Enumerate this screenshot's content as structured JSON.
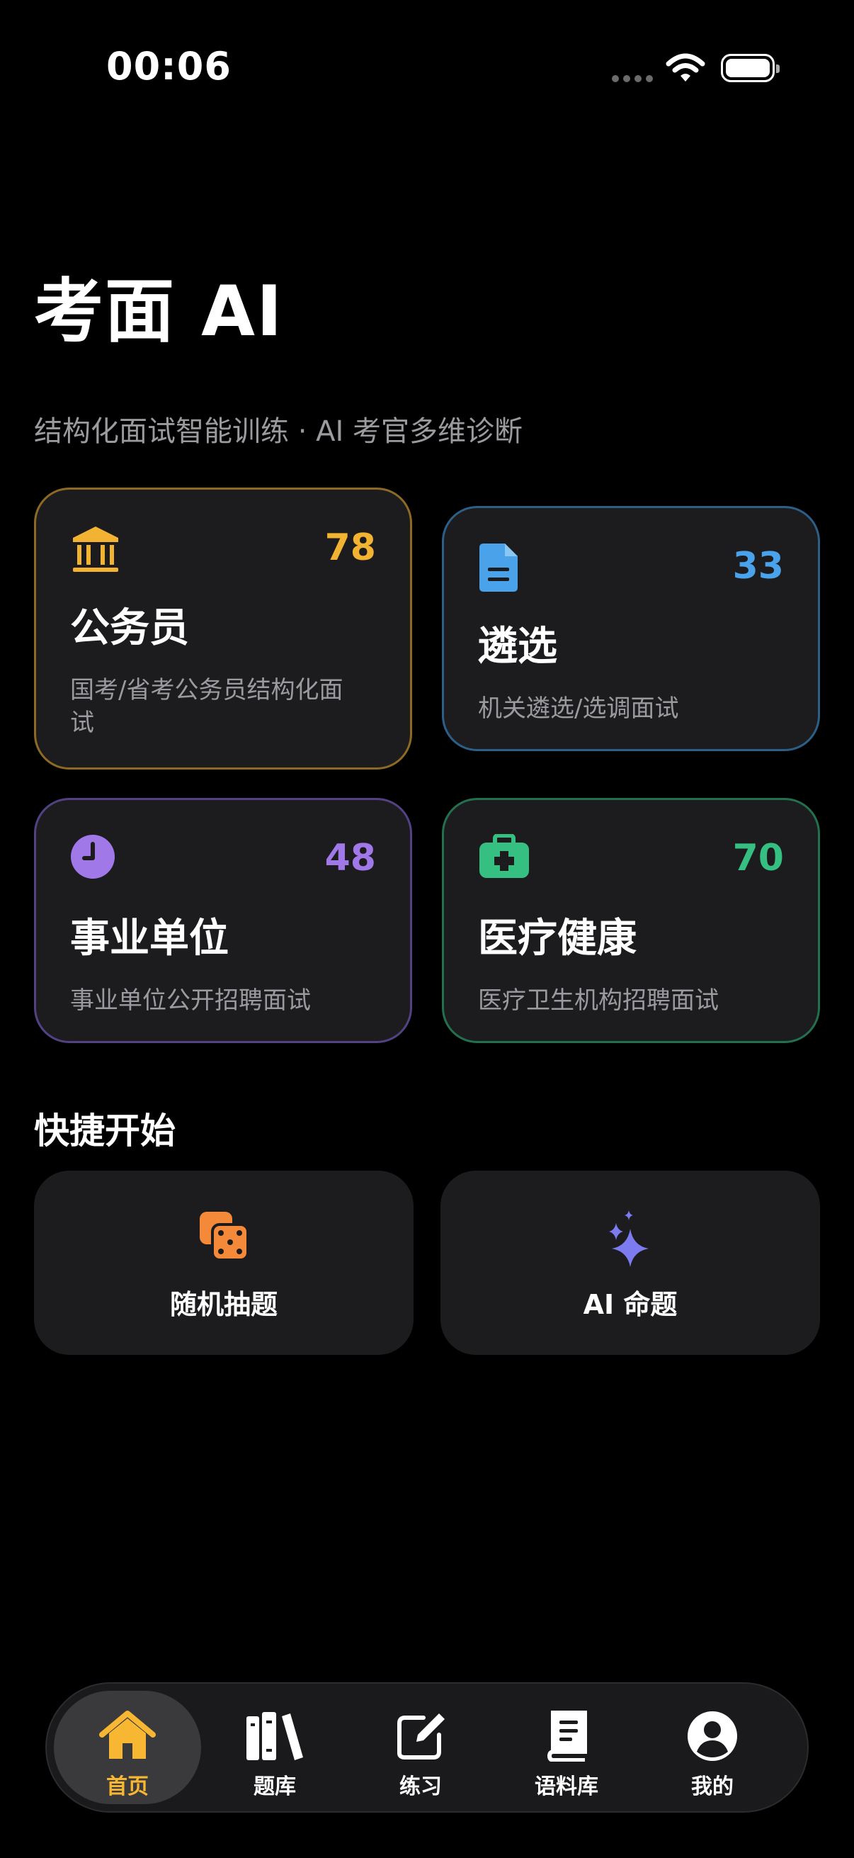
{
  "status_bar": {
    "time": "00:06"
  },
  "header": {
    "title": "考面 AI",
    "subtitle": "结构化面试智能训练 · AI 考官多维诊断"
  },
  "categories": [
    {
      "icon": "bank-icon",
      "title": "公务员",
      "count": "78",
      "desc": "国考/省考公务员结构化面试",
      "color": "#f2b232",
      "border": "#8d6a24"
    },
    {
      "icon": "document-icon",
      "title": "遴选",
      "count": "33",
      "desc": "机关遴选/选调面试",
      "color": "#4aa3ea",
      "border": "#2c5f87"
    },
    {
      "icon": "clock-icon",
      "title": "事业单位",
      "count": "48",
      "desc": "事业单位公开招聘面试",
      "color": "#a178e8",
      "border": "#524283"
    },
    {
      "icon": "medical-kit-icon",
      "title": "医疗健康",
      "count": "70",
      "desc": "医疗卫生机构招聘面试",
      "color": "#35c082",
      "border": "#23704f"
    }
  ],
  "quick_start": {
    "title": "快捷开始",
    "items": [
      {
        "icon": "dice-icon",
        "label": "随机抽题",
        "color": "#f5893a"
      },
      {
        "icon": "sparkles-icon",
        "label": "AI 命题",
        "color": "#7c7cf0"
      }
    ]
  },
  "tab_bar": {
    "items": [
      {
        "icon": "home-icon",
        "label": "首页",
        "active": true
      },
      {
        "icon": "books-icon",
        "label": "题库",
        "active": false
      },
      {
        "icon": "edit-icon",
        "label": "练习",
        "active": false
      },
      {
        "icon": "book-icon",
        "label": "语料库",
        "active": false
      },
      {
        "icon": "profile-icon",
        "label": "我的",
        "active": false
      }
    ],
    "accent": "#f7b733"
  }
}
